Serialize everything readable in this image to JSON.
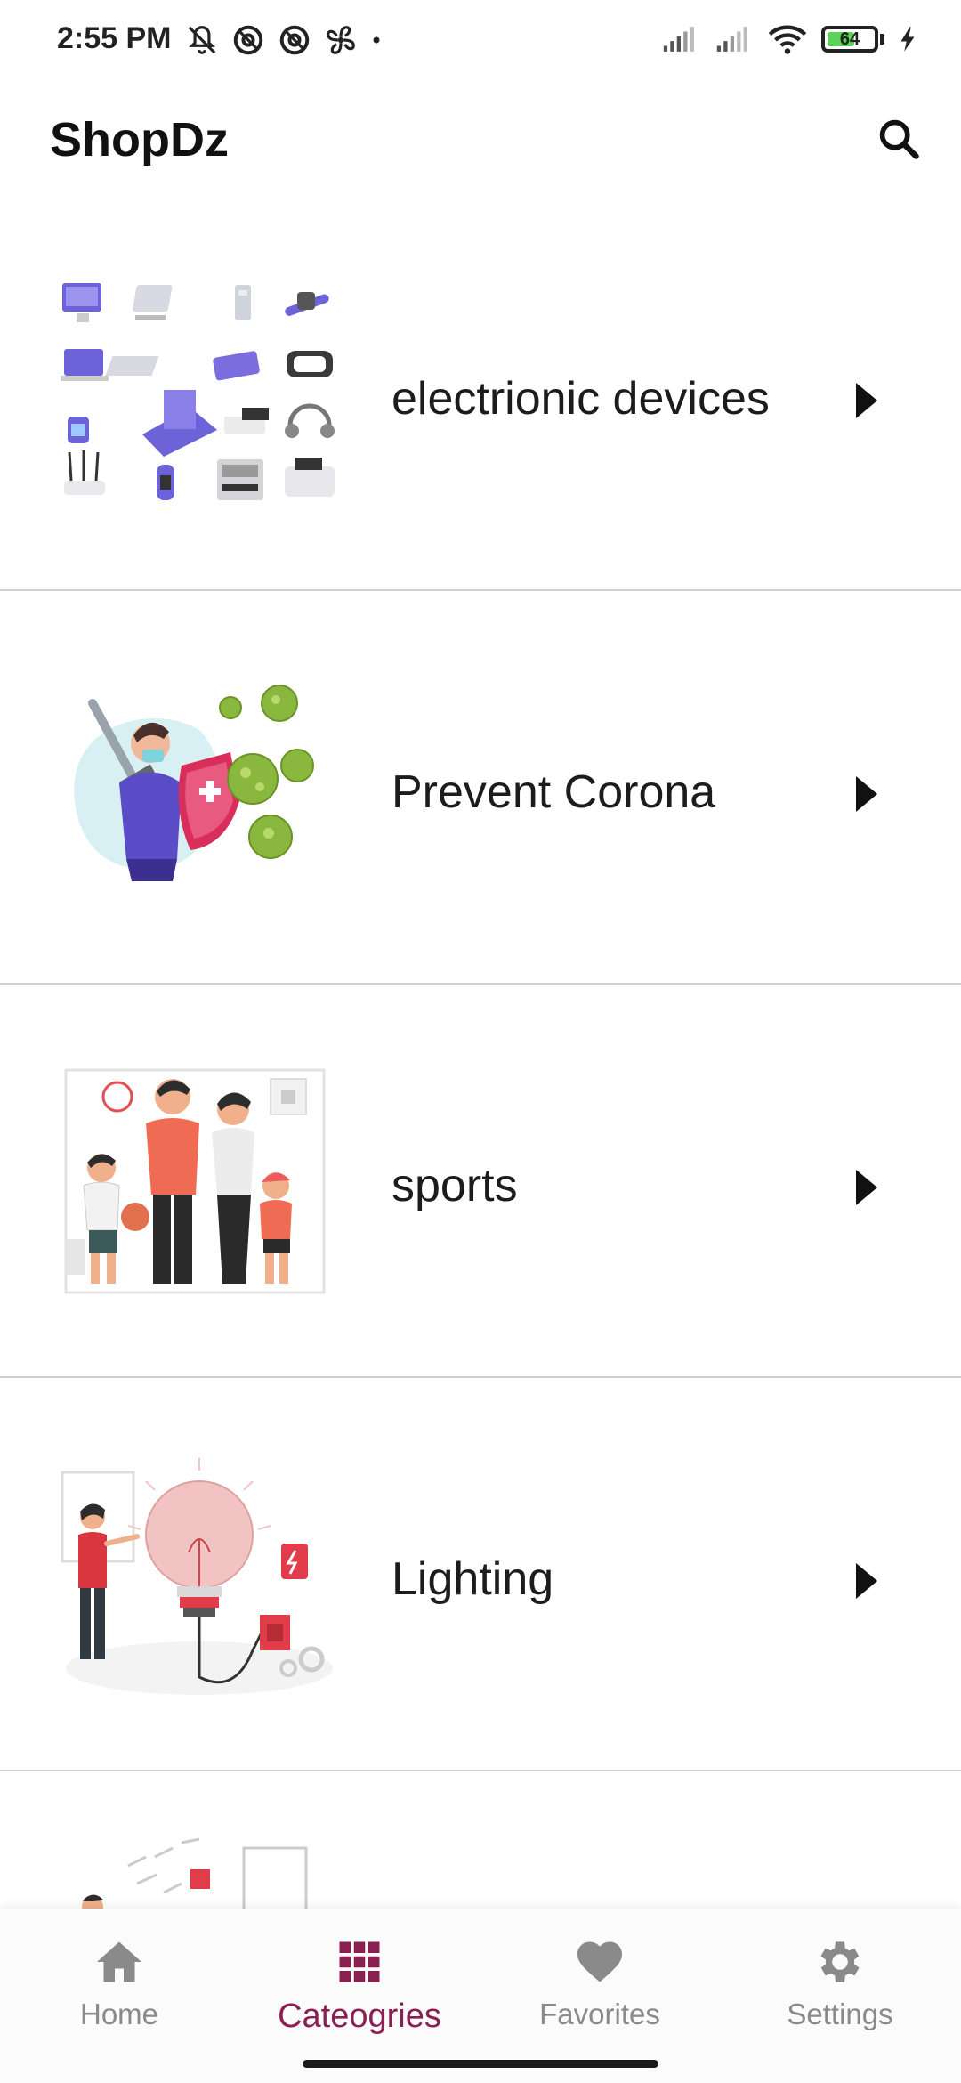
{
  "status_bar": {
    "time": "2:55 PM",
    "battery_level": "64",
    "left_icons": [
      "muted-bell-icon",
      "at-circle-icon",
      "at-circle-icon",
      "fan-icon",
      "dot-icon"
    ],
    "right_icons": [
      "signal-icon",
      "signal-icon",
      "wifi-icon",
      "battery-icon",
      "charging-bolt-icon"
    ]
  },
  "app_bar": {
    "title": "ShopDz",
    "search_icon": "search-icon"
  },
  "categories": [
    {
      "label": "electrionic devices",
      "image": "electronic-devices-illustration"
    },
    {
      "label": "Prevent Corona",
      "image": "prevent-corona-illustration"
    },
    {
      "label": "sports",
      "image": "sports-family-illustration"
    },
    {
      "label": "Lighting",
      "image": "lighting-bulb-illustration"
    }
  ],
  "bottom_nav": {
    "items": [
      {
        "label": "Home",
        "icon": "home-icon",
        "active": false
      },
      {
        "label": "Cateogries",
        "icon": "grid-icon",
        "active": true
      },
      {
        "label": "Favorites",
        "icon": "heart-icon",
        "active": false
      },
      {
        "label": "Settings",
        "icon": "gear-icon",
        "active": false
      }
    ]
  },
  "colors": {
    "accent": "#8c1f52",
    "inactive": "#8a8a8a",
    "divider": "#d0d0d0",
    "battery_fill": "#5bd25b"
  }
}
